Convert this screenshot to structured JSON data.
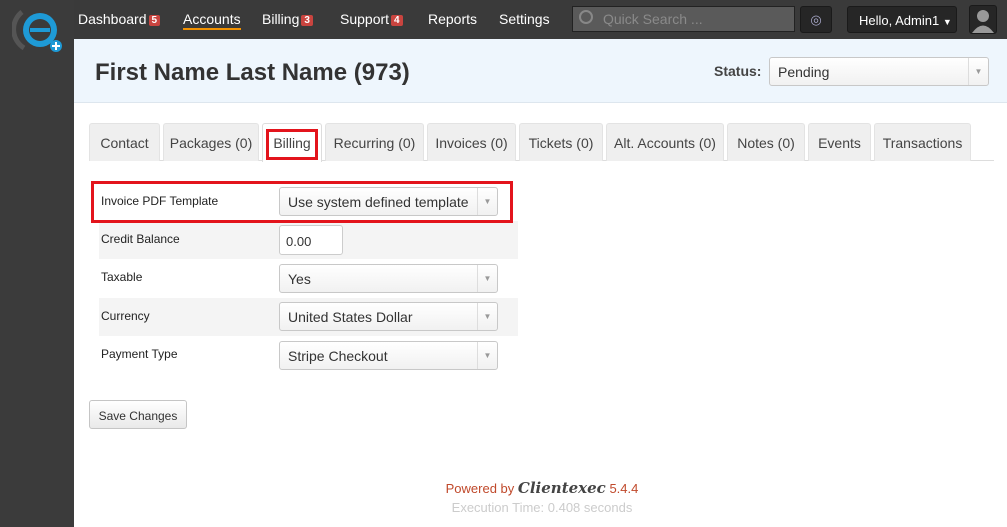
{
  "nav": {
    "items": [
      {
        "label": "Dashboard",
        "badge": "5"
      },
      {
        "label": "Accounts"
      },
      {
        "label": "Billing",
        "badge": "3"
      },
      {
        "label": "Support",
        "badge": "4"
      },
      {
        "label": "Reports"
      },
      {
        "label": "Settings"
      }
    ],
    "search_placeholder": "Quick Search ...",
    "user_label": "Hello, Admin1"
  },
  "header": {
    "title": "First Name Last Name (973)",
    "status_label": "Status:",
    "status_value": "Pending"
  },
  "tabs": [
    "Contact",
    "Packages (0)",
    "Billing",
    "Recurring (0)",
    "Invoices (0)",
    "Tickets (0)",
    "Alt. Accounts (0)",
    "Notes (0)",
    "Events",
    "Transactions"
  ],
  "form": {
    "invoice_template_label": "Invoice PDF Template",
    "invoice_template_value": "Use system defined template",
    "credit_label": "Credit Balance",
    "credit_value": "0.00",
    "taxable_label": "Taxable",
    "taxable_value": "Yes",
    "currency_label": "Currency",
    "currency_value": "United States Dollar",
    "payment_label": "Payment Type",
    "payment_value": "Stripe Checkout",
    "save_label": "Save Changes"
  },
  "footer": {
    "powered_by": "Powered by",
    "brand": "Clientexec",
    "version": "5.4.4",
    "execution": "Execution Time: 0.408 seconds"
  },
  "colors": {
    "accent": "#f39200",
    "badge": "#c9443f",
    "highlight": "#e3141c"
  }
}
